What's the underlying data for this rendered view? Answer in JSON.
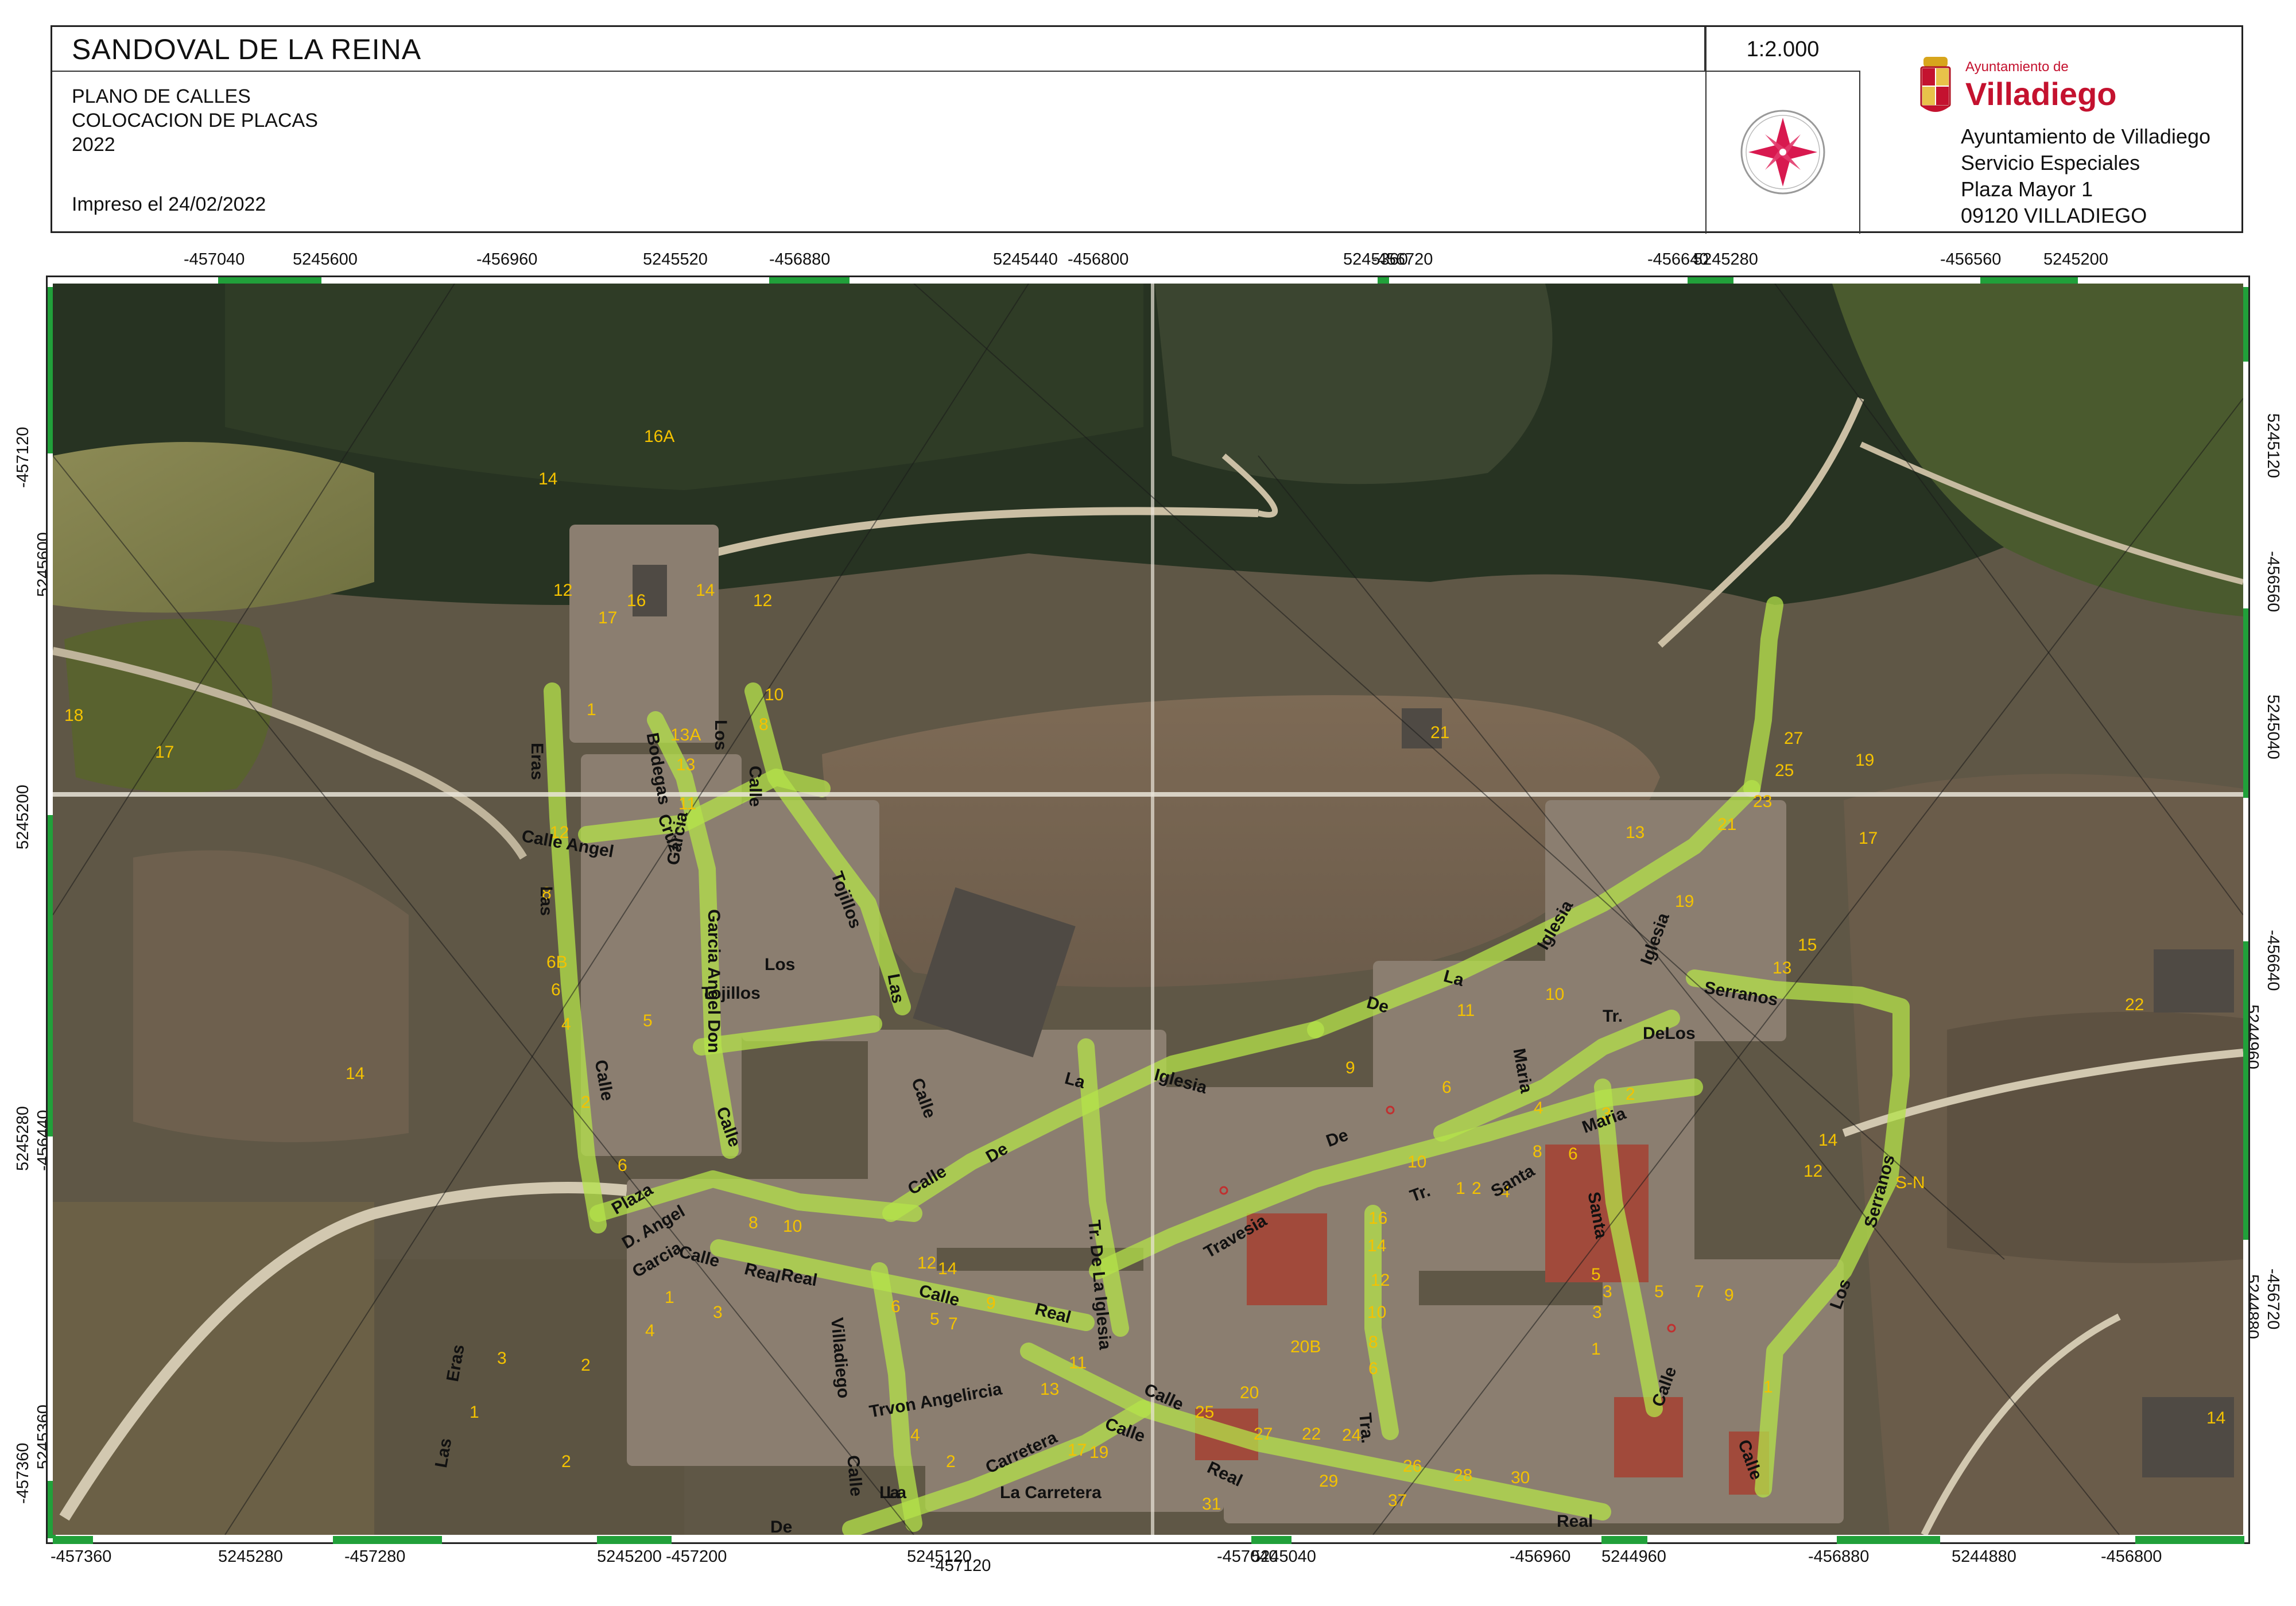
{
  "header": {
    "title": "SANDOVAL DE LA REINA",
    "subtitle_lines": [
      "PLANO DE CALLES",
      "COLOCACION DE PLACAS",
      "2022"
    ],
    "printed": "Impreso el 24/02/2022",
    "scale": "1:2.000",
    "org_small": "Ayuntamiento de",
    "org_big": "Villadiego",
    "org_lines": [
      "Ayuntamiento de Villadiego",
      "Servicio Especiales",
      "Plaza Mayor 1",
      "09120 VILLADIEGO"
    ]
  },
  "ticks": {
    "top": [
      "-457040",
      "5245600",
      "-456960",
      "5245520",
      "-456880",
      "5245440",
      "-456800",
      "5245360",
      "-456720",
      "-456640",
      "5245280",
      "-456560",
      "5245200"
    ],
    "bottom": [
      "-457360",
      "5245280",
      "-457280",
      "5245200",
      "-457200",
      "5245120",
      "-457120",
      "-457040",
      "5245040",
      "-456960",
      "5244960",
      "-456880",
      "5244880",
      "-456800"
    ],
    "left": [
      "-457120",
      "5245600",
      "5245200",
      "-456440",
      "5245280",
      "5245360",
      "-457360"
    ],
    "right": [
      "5245120",
      "-456560",
      "5245040",
      "-456640",
      "5244960",
      "-456720",
      "5244880"
    ]
  },
  "numbers": [
    {
      "t": "16A"
    },
    {
      "t": "14"
    },
    {
      "t": "12"
    },
    {
      "t": "17"
    },
    {
      "t": "16"
    },
    {
      "t": "14"
    },
    {
      "t": "12"
    },
    {
      "t": "18"
    },
    {
      "t": "17"
    },
    {
      "t": "1"
    },
    {
      "t": "10"
    },
    {
      "t": "8"
    },
    {
      "t": "13A"
    },
    {
      "t": "13"
    },
    {
      "t": "11"
    },
    {
      "t": "12"
    },
    {
      "t": "8"
    },
    {
      "t": "6B"
    },
    {
      "t": "6"
    },
    {
      "t": "4"
    },
    {
      "t": "2"
    },
    {
      "t": "6"
    },
    {
      "t": "5"
    },
    {
      "t": "14"
    },
    {
      "t": "21"
    },
    {
      "t": "27"
    },
    {
      "t": "25"
    },
    {
      "t": "19"
    },
    {
      "t": "23"
    },
    {
      "t": "21"
    },
    {
      "t": "17"
    },
    {
      "t": "13"
    },
    {
      "t": "19"
    },
    {
      "t": "15"
    },
    {
      "t": "13"
    },
    {
      "t": "22"
    },
    {
      "t": "10"
    },
    {
      "t": "11"
    },
    {
      "t": "9"
    },
    {
      "t": "6"
    },
    {
      "t": "4"
    },
    {
      "t": "2"
    },
    {
      "t": "10"
    },
    {
      "t": "8"
    },
    {
      "t": "6"
    },
    {
      "t": "3"
    },
    {
      "t": "1"
    },
    {
      "t": "2"
    },
    {
      "t": "4"
    },
    {
      "t": "12"
    },
    {
      "t": "14"
    },
    {
      "t": "S-N"
    },
    {
      "t": "5"
    },
    {
      "t": "3"
    },
    {
      "t": "1"
    },
    {
      "t": "9"
    },
    {
      "t": "7"
    },
    {
      "t": "5"
    },
    {
      "t": "3"
    },
    {
      "t": "1"
    },
    {
      "t": "16"
    },
    {
      "t": "14"
    },
    {
      "t": "12"
    },
    {
      "t": "10"
    },
    {
      "t": "8"
    },
    {
      "t": "6"
    },
    {
      "t": "20B"
    },
    {
      "t": "20"
    },
    {
      "t": "25"
    },
    {
      "t": "27"
    },
    {
      "t": "22"
    },
    {
      "t": "24"
    },
    {
      "t": "26"
    },
    {
      "t": "28"
    },
    {
      "t": "30"
    },
    {
      "t": "37"
    },
    {
      "t": "31"
    },
    {
      "t": "29"
    },
    {
      "t": "17"
    },
    {
      "t": "19"
    },
    {
      "t": "13"
    },
    {
      "t": "11"
    },
    {
      "t": "2"
    },
    {
      "t": "4"
    },
    {
      "t": "6"
    },
    {
      "t": "9"
    },
    {
      "t": "7"
    },
    {
      "t": "5"
    },
    {
      "t": "3"
    },
    {
      "t": "1"
    },
    {
      "t": "14"
    },
    {
      "t": "12"
    },
    {
      "t": "10"
    },
    {
      "t": "8"
    },
    {
      "t": "2"
    },
    {
      "t": "4"
    },
    {
      "t": "3"
    },
    {
      "t": "1"
    },
    {
      "t": "2"
    },
    {
      "t": "14"
    }
  ],
  "streets": [
    {
      "t": "Eras"
    },
    {
      "t": "Bodegas"
    },
    {
      "t": "Cruz"
    },
    {
      "t": "Calle Angel"
    },
    {
      "t": "Garcia"
    },
    {
      "t": "Los"
    },
    {
      "t": "Calle"
    },
    {
      "t": "Tojillos"
    },
    {
      "t": "Las"
    },
    {
      "t": "Garcia Angel Don"
    },
    {
      "t": "Los"
    },
    {
      "t": "Tojillos"
    },
    {
      "t": "Las"
    },
    {
      "t": "Calle"
    },
    {
      "t": "Calle"
    },
    {
      "t": "Calle"
    },
    {
      "t": "Plaza"
    },
    {
      "t": "D. Angel"
    },
    {
      "t": "Garcia"
    },
    {
      "t": "Calle"
    },
    {
      "t": "Real"
    },
    {
      "t": "Calle"
    },
    {
      "t": "De"
    },
    {
      "t": "Calle"
    },
    {
      "t": "Real"
    },
    {
      "t": "La"
    },
    {
      "t": "Iglesia"
    },
    {
      "t": "De"
    },
    {
      "t": "La"
    },
    {
      "t": "Iglesia"
    },
    {
      "t": "Iglesia"
    },
    {
      "t": "Serranos"
    },
    {
      "t": "Tr."
    },
    {
      "t": "DeLos"
    },
    {
      "t": "Maria"
    },
    {
      "t": "Maria"
    },
    {
      "t": "Santa"
    },
    {
      "t": "Santa"
    },
    {
      "t": "De"
    },
    {
      "t": "Tr."
    },
    {
      "t": "Travesia"
    },
    {
      "t": "Tr. De La Iglesia"
    },
    {
      "t": "Villadiego"
    },
    {
      "t": "Calle"
    },
    {
      "t": "Trvon Angelircia"
    },
    {
      "t": "Carretera"
    },
    {
      "t": "La"
    },
    {
      "t": "La Carretera"
    },
    {
      "t": "Calle"
    },
    {
      "t": "Calle"
    },
    {
      "t": "Real"
    },
    {
      "t": "Real"
    },
    {
      "t": "Tra."
    },
    {
      "t": "Calle"
    },
    {
      "t": "Real"
    },
    {
      "t": "Calle"
    },
    {
      "t": "Los"
    },
    {
      "t": "Serranos"
    },
    {
      "t": "Eras"
    },
    {
      "t": "Las"
    },
    {
      "t": "De"
    },
    {
      "t": "La"
    }
  ]
}
